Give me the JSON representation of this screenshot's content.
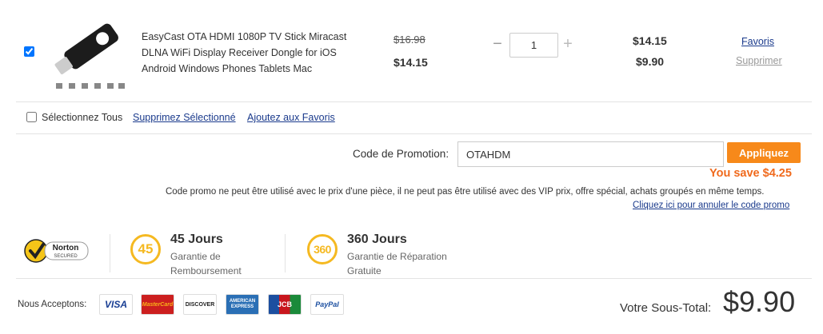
{
  "product": {
    "title": "EasyCast OTA HDMI 1080P TV Stick Miracast DLNA WiFi Display Receiver Dongle for iOS Android Windows Phones Tablets Mac",
    "old_price": "$16.98",
    "unit_price": "$14.15",
    "quantity": "1",
    "qty_minus": "−",
    "qty_plus": "+",
    "total_original": "$14.15",
    "total_discounted": "$9.90",
    "favoris_link": "Favoris",
    "supprimer_link": "Supprimer",
    "checked": true
  },
  "selection_bar": {
    "select_all_label": "Sélectionnez Tous",
    "delete_selected": "Supprimez Sélectionné",
    "add_favorites": "Ajoutez aux Favoris"
  },
  "promo": {
    "label": "Code de Promotion:",
    "value": "OTAHDM",
    "apply_button": "Appliquez",
    "saving": "You save $4.25",
    "note": "Code promo ne peut être utilisé avec le prix d'une pièce, il ne peut pas être utilisé avec des VIP prix, offre spécial, achats groupés en même temps.",
    "cancel_link": "Cliquez ici pour annuler le code promo"
  },
  "guarantees": {
    "norton_line1": "Norton",
    "norton_line2": "SECURED",
    "refund_badge": "45",
    "refund_title": "45 Jours",
    "refund_sub": "Garantie de Remboursement",
    "repair_badge": "360",
    "repair_title": "360 Jours",
    "repair_sub": "Garantie de Réparation Gratuite"
  },
  "payments": {
    "label": "Nous Acceptons:",
    "cards": [
      "VISA",
      "MasterCard",
      "DISCOVER",
      "AMERICAN EXPRESS",
      "JCB",
      "PayPal"
    ]
  },
  "subtotal": {
    "label": "Votre Sous-Total:",
    "value": "$9.90"
  },
  "colors": {
    "accent": "#f7891a",
    "saving": "#f06a1d",
    "badge": "#f5b921",
    "link": "#1a3a8c"
  }
}
